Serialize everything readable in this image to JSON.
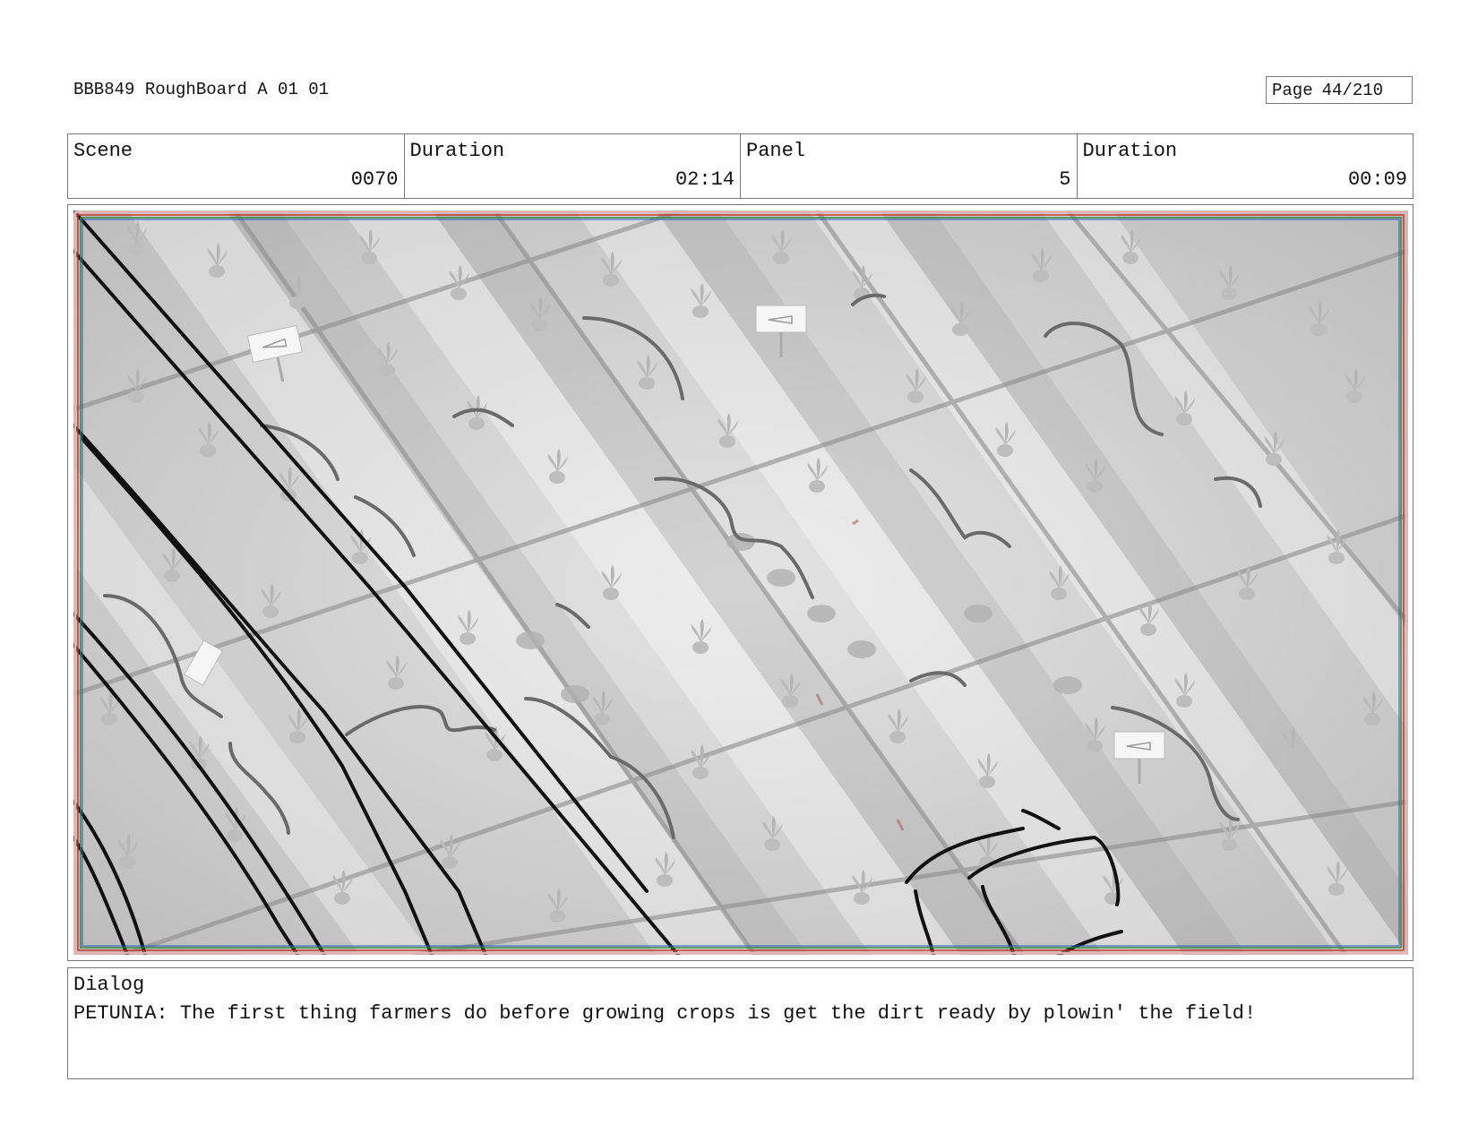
{
  "header": {
    "title": "BBB849 RoughBoard A 01 01",
    "page_label": "Page",
    "page_number": "44/210"
  },
  "info": {
    "scene_label": "Scene",
    "scene_value": "0070",
    "scene_duration_label": "Duration",
    "scene_duration_value": "02:14",
    "panel_label": "Panel",
    "panel_value": "5",
    "panel_duration_label": "Duration",
    "panel_duration_value": "00:09"
  },
  "panel": {
    "image": "storyboard-sketch-plowed-carrot-field",
    "colors": {
      "safe_frame_green": "#2e8b3a",
      "safe_frame_red": "#c0392b",
      "safe_frame_blue": "#3050c0"
    }
  },
  "dialog": {
    "label": "Dialog",
    "text": "PETUNIA: The first thing farmers do before growing crops is get the dirt ready by plowin' the field!"
  }
}
